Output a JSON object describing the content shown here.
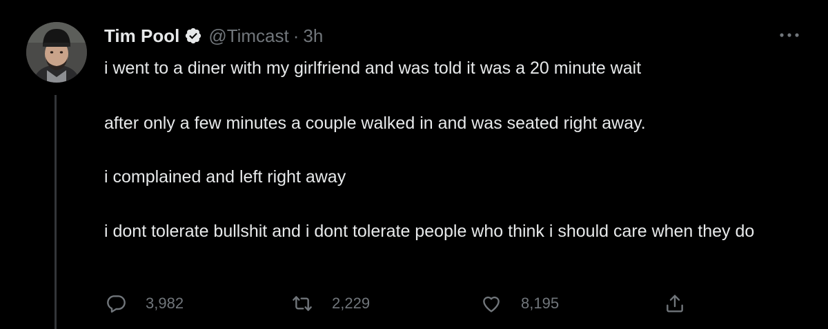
{
  "tweet": {
    "display_name": "Tim Pool",
    "handle": "@Timcast",
    "separator": "·",
    "time": "3h",
    "paragraphs": [
      "i went to a diner with my girlfriend and was told it was a 20 minute wait",
      "after only a few minutes a couple walked in and was seated right away.",
      "i complained and left right away",
      "i dont tolerate bullshit and i dont tolerate people who think i should care when they do"
    ],
    "stats": {
      "replies": "3,982",
      "retweets": "2,229",
      "likes": "8,195"
    }
  },
  "icons": {
    "verified": "verified-badge-icon",
    "more": "more-options-icon",
    "reply": "reply-icon",
    "retweet": "retweet-icon",
    "like": "heart-icon",
    "share": "share-icon"
  },
  "colors": {
    "background": "#000000",
    "text_primary": "#e7e9ea",
    "text_secondary": "#71767b",
    "thread_line": "#333639"
  }
}
